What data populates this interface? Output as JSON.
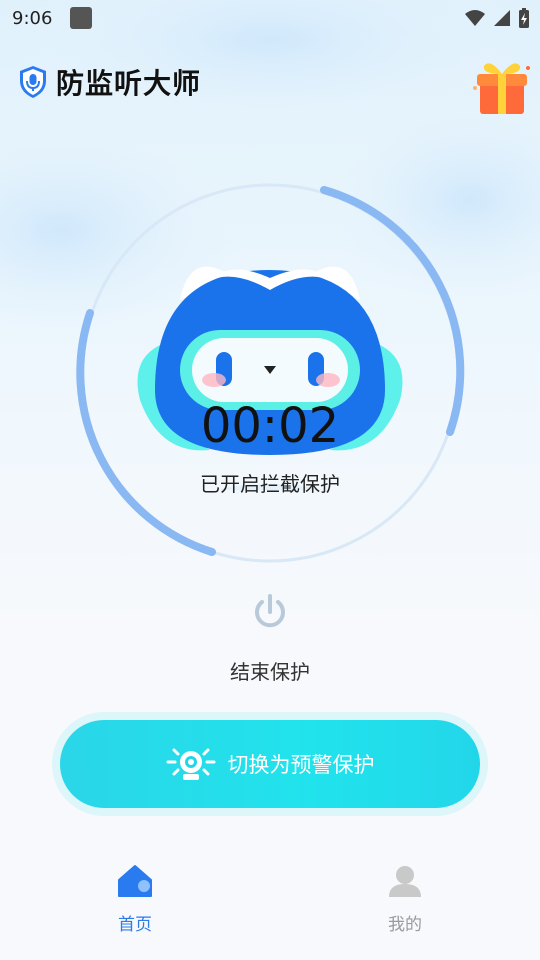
{
  "status_bar": {
    "time": "9:06"
  },
  "header": {
    "title": "防监听大师"
  },
  "protection": {
    "timer": "00:02",
    "status": "已开启拦截保护"
  },
  "actions": {
    "end_label": "结束保护",
    "switch_label": "切换为预警保护"
  },
  "nav": {
    "items": [
      {
        "label": "首页",
        "active": true
      },
      {
        "label": "我的",
        "active": false
      }
    ]
  },
  "colors": {
    "accent": "#2a7bf0",
    "button": "#22dde9",
    "inactive": "#9a9a9a"
  },
  "icons": [
    "shield-mic-icon",
    "gift-icon",
    "power-icon",
    "alarm-camera-icon",
    "home-icon",
    "user-icon",
    "wifi-icon",
    "signal-icon",
    "battery-icon"
  ]
}
